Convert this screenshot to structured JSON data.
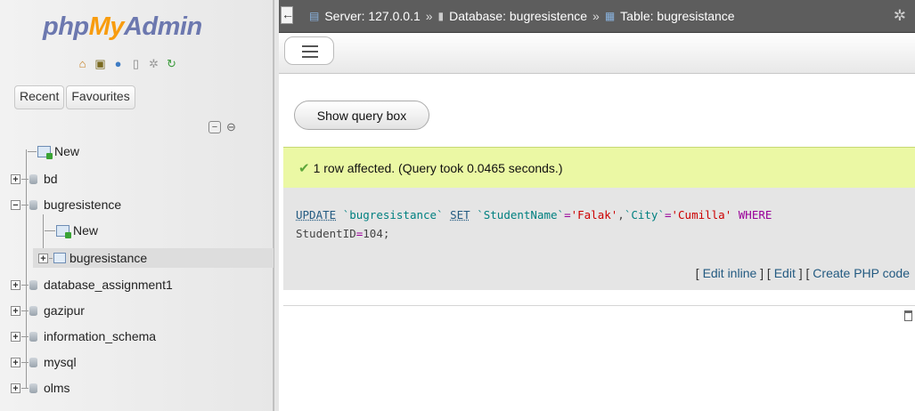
{
  "sidebar": {
    "logo": {
      "php": "php",
      "my": "My",
      "admin": "Admin"
    },
    "icons": [
      "home-icon",
      "exit-icon",
      "help-icon",
      "docs-icon",
      "settings-icon",
      "reload-icon"
    ],
    "tabs": [
      "Recent",
      "Favourites"
    ],
    "tree": [
      {
        "label": "New",
        "kind": "new"
      },
      {
        "label": "bd",
        "kind": "db"
      },
      {
        "label": "bugresistence",
        "kind": "db-open"
      },
      {
        "label": "New",
        "kind": "new-child"
      },
      {
        "label": "bugresistance",
        "kind": "table"
      },
      {
        "label": "database_assignment1",
        "kind": "db"
      },
      {
        "label": "gazipur",
        "kind": "db"
      },
      {
        "label": "information_schema",
        "kind": "db"
      },
      {
        "label": "mysql",
        "kind": "db"
      },
      {
        "label": "olms",
        "kind": "db"
      }
    ]
  },
  "breadcrumb": {
    "server": "Server: 127.0.0.1",
    "database": "Database: bugresistence",
    "table": "Table: bugresistance",
    "separator": "»"
  },
  "main": {
    "show_query_label": "Show query box",
    "success_message": "1 row affected. (Query took 0.0465 seconds.)",
    "sql": {
      "update": "UPDATE",
      "table": "`bugresistance`",
      "set": "SET",
      "col1": "`StudentName`",
      "eq": "=",
      "val1": "'Falak'",
      "comma": ",",
      "col2": "`City`",
      "val2": "'Cumilla'",
      "where": "WHERE",
      "col3": "StudentID",
      "val3": "104",
      "end": ";"
    },
    "links": {
      "edit_inline": "Edit inline",
      "edit": "Edit",
      "create_php": "Create PHP code"
    }
  },
  "colors": {
    "topbar": "#5d5d5d",
    "success_bg": "#ebf8a4",
    "sql_bg": "#e5e5e5",
    "link": "#235a81",
    "logo_blue": "#6c78af",
    "logo_orange": "#f89c0e"
  }
}
